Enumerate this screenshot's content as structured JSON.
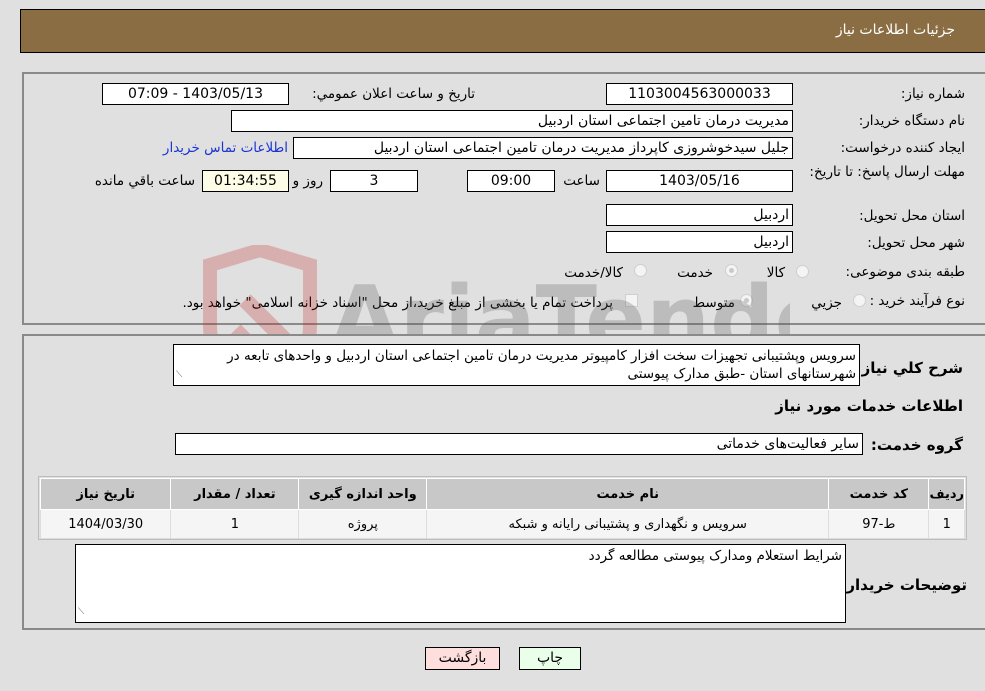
{
  "header": {
    "title": "جزئیات اطلاعات نیاز"
  },
  "form": {
    "need_number_label": "شماره نیاز:",
    "need_number": "1103004563000033",
    "announce_label": "تاریخ و ساعت اعلان عمومي:",
    "announce_value": "1403/05/13 - 07:09",
    "buyer_org_label": "نام دستگاه خریدار:",
    "buyer_org": "مدیریت درمان تامین اجتماعی استان اردبیل",
    "creator_label": "ایجاد کننده درخواست:",
    "creator": "جلیل سیدخوشروزی کاپرداز مدیریت درمان تامین اجتماعی استان اردبیل",
    "contact_link": "اطلاعات تماس خریدار",
    "deadline_label": "مهلت ارسال پاسخ: تا تاریخ:",
    "deadline_date": "1403/05/16",
    "time_label": "ساعت",
    "deadline_time": "09:00",
    "days_value": "3",
    "days_label": "روز و",
    "remaining_time": "01:34:55",
    "remaining_label": "ساعت باقي مانده",
    "province_label": "استان محل تحویل:",
    "province": "اردبیل",
    "city_label": "شهر محل تحویل:",
    "city": "اردبیل",
    "category_label": "طبقه بندی موضوعی:",
    "category_options": [
      "کالا",
      "خدمت",
      "کالا/خدمت"
    ],
    "category_selected": "خدمت",
    "process_label": "نوع فرآیند خرید :",
    "process_options": [
      "جزیي",
      "متوسط"
    ],
    "process_selected": "متوسط",
    "payment_note": "پرداخت تمام یا بخشی از مبلغ خرید،از محل \"اسناد خزانه اسلامی\" خواهد بود."
  },
  "details": {
    "description_label": "شرح کلي نیاز:",
    "description": "سرویس وپشتیبانی تجهیزات سخت افزار کامپیوتر مدیریت درمان تامین اجتماعی استان اردبیل و واحدهای تابعه در شهرستانهای استان -طبق مدارک پیوستی",
    "services_heading": "اطلاعات خدمات مورد نیاز",
    "service_group_label": "گروه خدمت:",
    "service_group": "سایر فعالیت‌های خدماتی",
    "table": {
      "headers": [
        "ردیف",
        "کد خدمت",
        "نام خدمت",
        "واحد اندازه گیری",
        "تعداد / مقدار",
        "تاریخ نیاز"
      ],
      "rows": [
        [
          "1",
          "ط-97",
          "سرویس و نگهداری و پشتیبانی رایانه و شبکه",
          "پروژه",
          "1",
          "1404/03/30"
        ]
      ]
    },
    "buyer_notes_label": "توضیحات خریدار:",
    "buyer_notes": "شرایط استعلام ومدارک پیوستی مطالعه گردد"
  },
  "buttons": {
    "print": "چاپ",
    "back": "بازگشت"
  },
  "watermark": "AriaTender.neT"
}
